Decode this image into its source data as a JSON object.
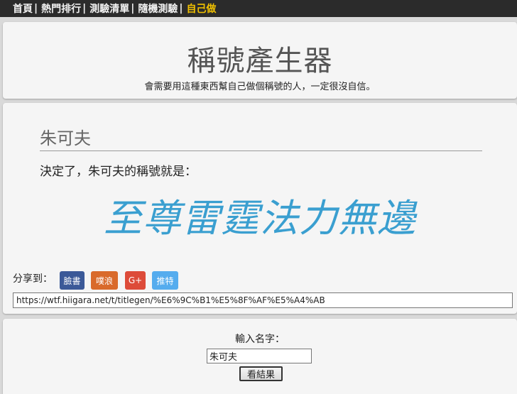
{
  "nav": {
    "items": [
      {
        "label": "首頁"
      },
      {
        "label": "熱門排行"
      },
      {
        "label": "測驗清單"
      },
      {
        "label": "隨機測驗"
      },
      {
        "label": "自己做"
      }
    ],
    "separator": "|",
    "active_color": "#f0c000"
  },
  "header": {
    "title": "稱號產生器",
    "subtitle": "會需要用這種東西幫自己做個稱號的人，一定很沒自信。"
  },
  "result": {
    "name": "朱可夫",
    "sentence": "決定了，朱可夫的稱號就是：",
    "generated_title": "至尊雷霆法力無邊",
    "title_color": "#3a9fd0"
  },
  "share": {
    "label": "分享到：",
    "buttons": [
      {
        "label": "臉書",
        "color": "#3b5998"
      },
      {
        "label": "噗浪",
        "color": "#d96a2b"
      },
      {
        "label": "G+",
        "color": "#dd4b39"
      },
      {
        "label": "推特",
        "color": "#55acee"
      }
    ],
    "url": "https://wtf.hiigara.net/t/titlegen/%E6%9C%B1%E5%8F%AF%E5%A4%AB"
  },
  "form": {
    "label": "輸入名字：",
    "name_value": "朱可夫",
    "submit_label": "看結果"
  }
}
